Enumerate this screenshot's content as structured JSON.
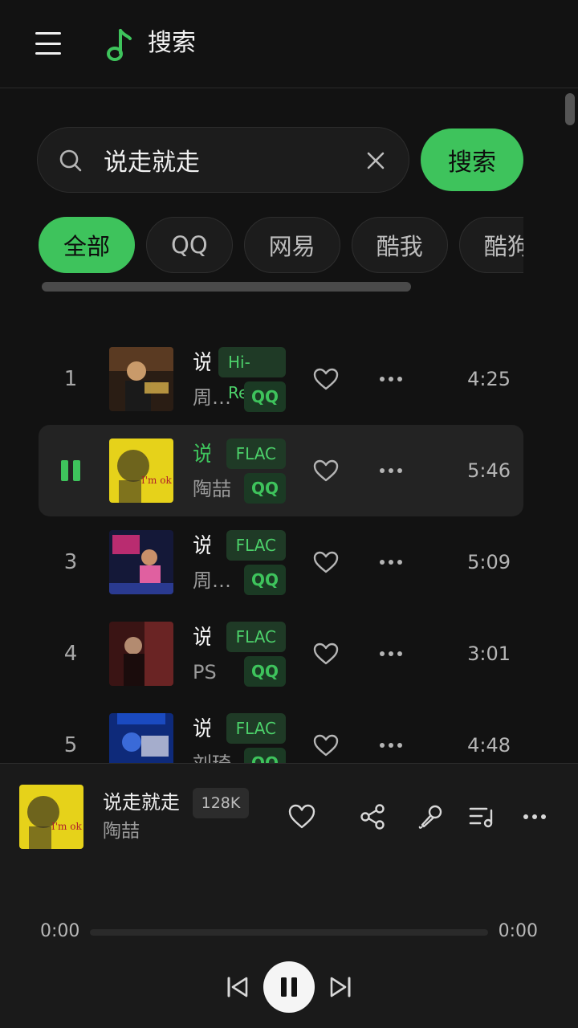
{
  "header": {
    "title": "搜索"
  },
  "search": {
    "query": "说走就走",
    "button_label": "搜索"
  },
  "sources": [
    {
      "label": "全部",
      "active": true
    },
    {
      "label": "QQ",
      "active": false
    },
    {
      "label": "网易",
      "active": false
    },
    {
      "label": "酷我",
      "active": false
    },
    {
      "label": "酷狗",
      "active": false
    }
  ],
  "songs": [
    {
      "index": "1",
      "title": "说走就走",
      "artist": "周传雄",
      "quality": "Hi-Res",
      "source": "QQ",
      "duration": "4:25",
      "playing": false
    },
    {
      "index": "2",
      "title": "说走就走",
      "artist": "陶喆",
      "quality": "FLAC",
      "source": "QQ",
      "duration": "5:46",
      "playing": true
    },
    {
      "index": "3",
      "title": "说走就走",
      "artist": "周传雄",
      "quality": "FLAC",
      "source": "QQ",
      "duration": "5:09",
      "playing": false
    },
    {
      "index": "4",
      "title": "说走就走",
      "artist": "PS",
      "quality": "FLAC",
      "source": "QQ",
      "duration": "3:01",
      "playing": false
    },
    {
      "index": "5",
      "title": "说走就走",
      "artist": "刘琦",
      "quality": "FLAC",
      "source": "QQ",
      "duration": "4:48",
      "playing": false
    }
  ],
  "player": {
    "title": "说走就走",
    "artist": "陶喆",
    "quality": "128K",
    "time_current": "0:00",
    "time_total": "0:00",
    "progress": 0
  },
  "colors": {
    "accent": "#3ec35c",
    "background": "#121212",
    "surface": "#1c1c1c"
  }
}
